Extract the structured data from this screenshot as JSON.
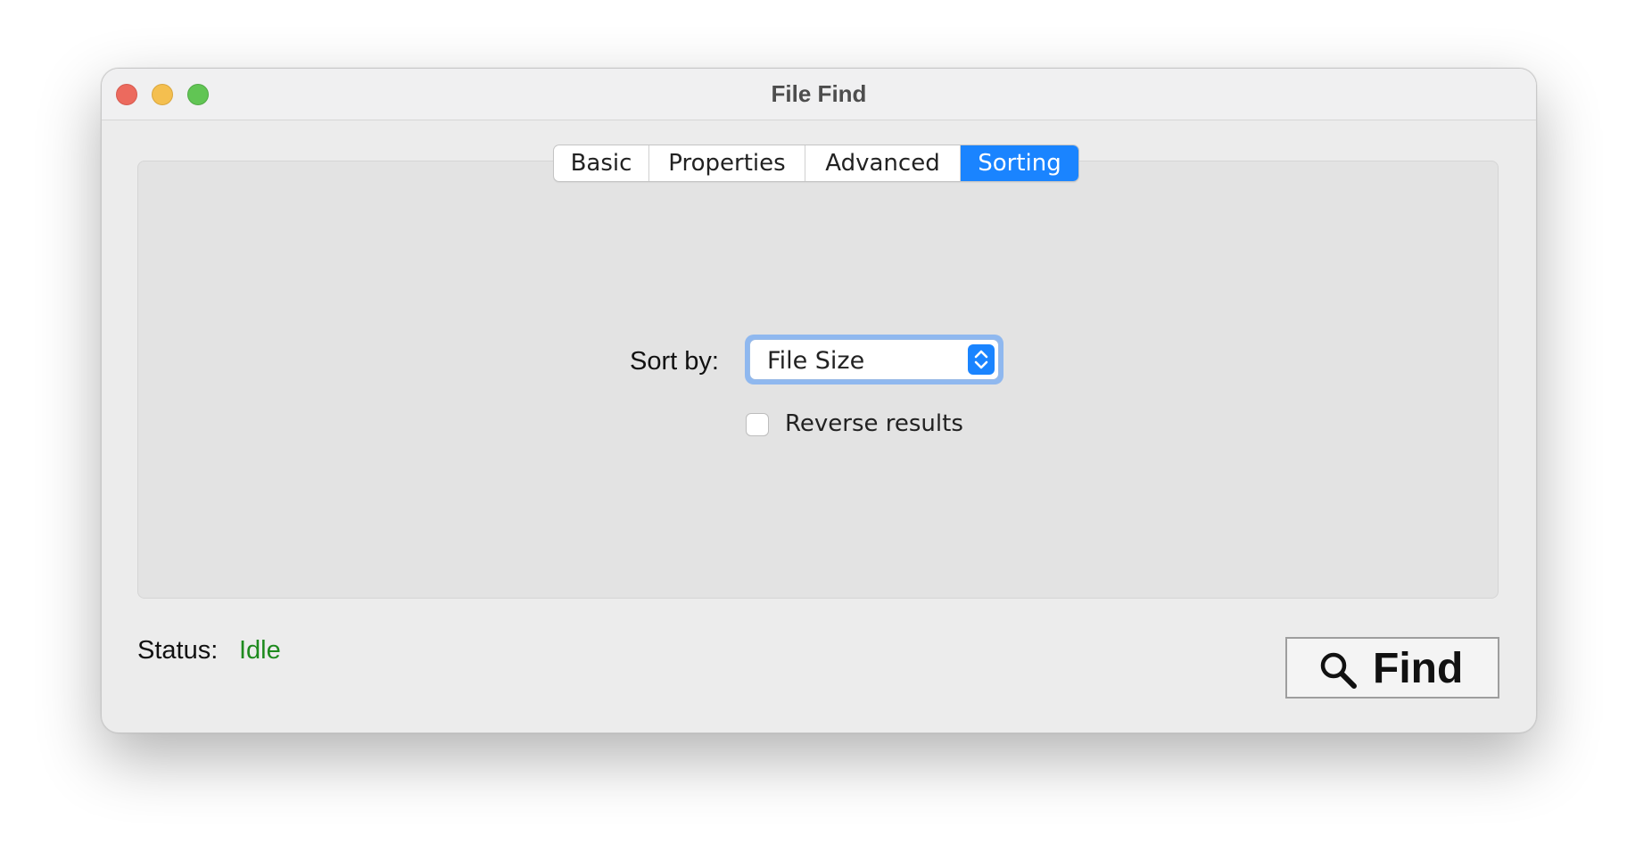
{
  "window": {
    "title": "File Find"
  },
  "tabs": [
    {
      "label": "Basic",
      "selected": false
    },
    {
      "label": "Properties",
      "selected": false
    },
    {
      "label": "Advanced",
      "selected": false
    },
    {
      "label": "Sorting",
      "selected": true
    }
  ],
  "sorting": {
    "sort_label": "Sort by:",
    "sort_value": "File Size",
    "reverse_label": "Reverse results",
    "reverse_checked": false
  },
  "status": {
    "label": "Status:",
    "value": "Idle",
    "value_color": "#1e8a1e"
  },
  "find_button": {
    "label": "Find",
    "icon": "magnifier-icon"
  },
  "colors": {
    "accent": "#1a84ff",
    "traffic_close": "#ec6a5e",
    "traffic_minimize": "#f4bf4f",
    "traffic_zoom": "#61c554"
  }
}
